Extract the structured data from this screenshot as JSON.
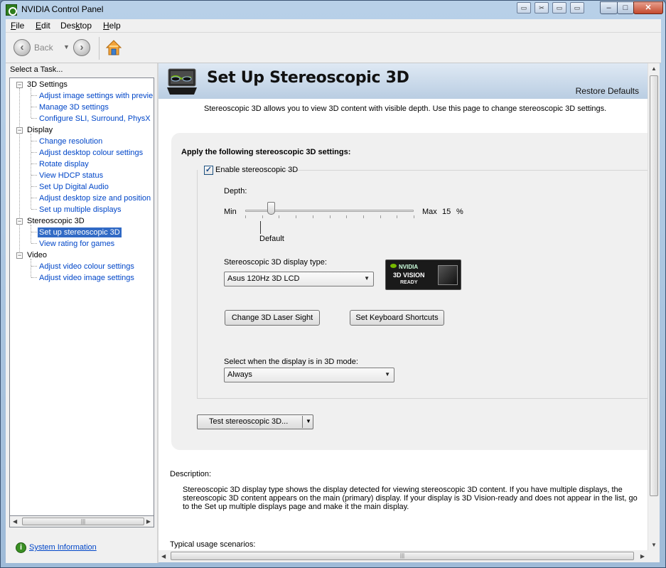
{
  "window": {
    "title": "NVIDIA Control Panel",
    "controls": {
      "minimize": "–",
      "maximize": "□",
      "close": "✕"
    }
  },
  "menu": [
    {
      "label": "File",
      "key": "F"
    },
    {
      "label": "Edit",
      "key": "E"
    },
    {
      "label": "Desktop",
      "key": "k"
    },
    {
      "label": "Help",
      "key": "H"
    }
  ],
  "toolbar": {
    "back_label": "Back",
    "back_icon": "arrow-left-icon",
    "forward_icon": "arrow-right-icon",
    "home_icon": "home-icon"
  },
  "sidebar": {
    "task_label": "Select a Task...",
    "categories": [
      {
        "label": "3D Settings",
        "items": [
          "Adjust image settings with previe",
          "Manage 3D settings",
          "Configure SLI, Surround, PhysX"
        ]
      },
      {
        "label": "Display",
        "items": [
          "Change resolution",
          "Adjust desktop colour settings",
          "Rotate display",
          "View HDCP status",
          "Set Up Digital Audio",
          "Adjust desktop size and position",
          "Set up multiple displays"
        ]
      },
      {
        "label": "Stereoscopic 3D",
        "items": [
          "Set up stereoscopic 3D",
          "View rating for games"
        ]
      },
      {
        "label": "Video",
        "items": [
          "Adjust video colour settings",
          "Adjust video image settings"
        ]
      }
    ],
    "selected": "Set up stereoscopic 3D",
    "system_info": "System Information"
  },
  "page": {
    "title": "Set Up Stereoscopic 3D",
    "restore_defaults": "Restore Defaults",
    "description": "Stereoscopic 3D allows you to view 3D content with visible depth. Use this page to change stereoscopic 3D settings.",
    "apply_heading": "Apply the following stereoscopic 3D settings:",
    "enable_label": "Enable stereoscopic 3D",
    "enable_checked": true,
    "depth": {
      "label": "Depth:",
      "min_label": "Min",
      "max_label": "Max",
      "value": "15",
      "unit": "%",
      "default_label": "Default",
      "fraction": 0.15
    },
    "display_type": {
      "label": "Stereoscopic 3D display type:",
      "value": "Asus 120Hz 3D LCD"
    },
    "vision_badge": {
      "brand": "NVIDIA",
      "product": "3D VISION",
      "status": "READY"
    },
    "laser_button": "Change 3D Laser Sight",
    "keyboard_button": "Set Keyboard Shortcuts",
    "mode": {
      "label": "Select when the display is in 3D mode:",
      "value": "Always"
    },
    "test_button": "Test stereoscopic 3D...",
    "desc_heading": "Description:",
    "desc_text": "Stereoscopic 3D display type shows the display detected for viewing stereoscopic 3D content. If you have multiple displays, the stereoscopic 3D content appears on the main (primary) display. If your display is 3D Vision-ready and does not appear in the list, go to the Set up multiple displays page and make it the main display.",
    "usage_heading": "Typical usage scenarios:"
  }
}
